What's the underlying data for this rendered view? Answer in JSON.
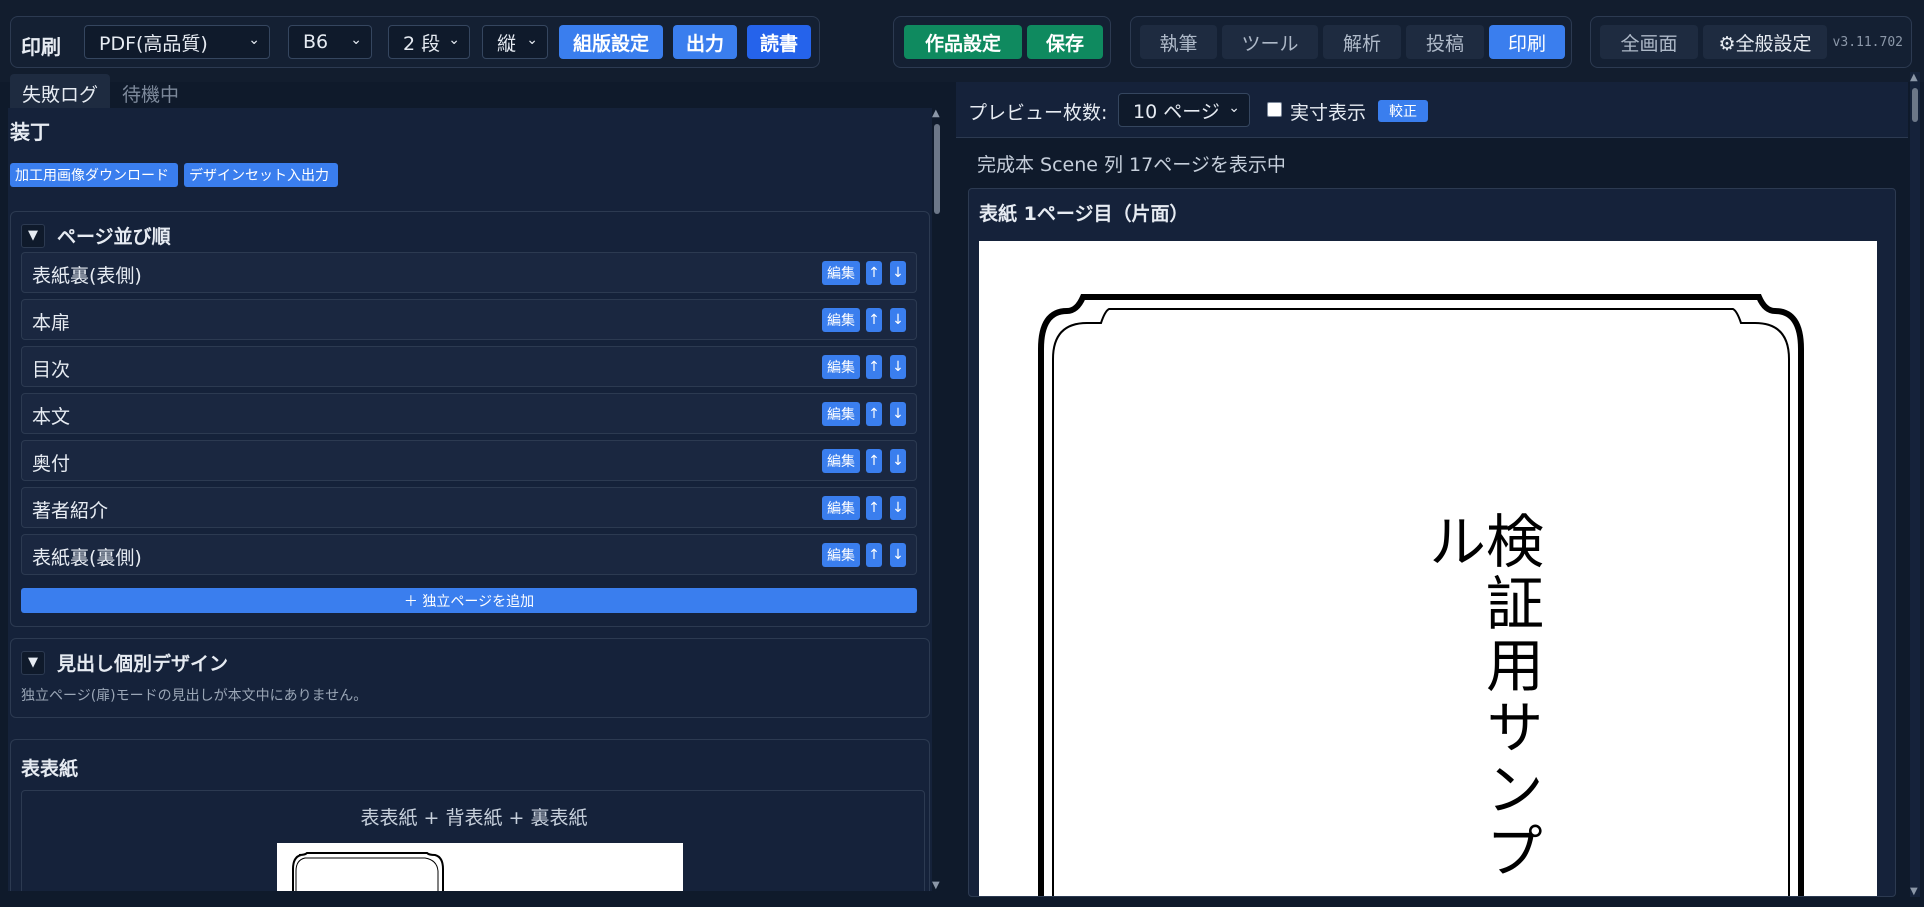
{
  "toolbar": {
    "title": "印刷",
    "format": "PDF(高品質)",
    "size": "B6",
    "columns": "2 段",
    "direction": "縦",
    "layout_btn": "組版設定",
    "output_btn": "出力",
    "read_btn": "読書",
    "work_settings_btn": "作品設定",
    "save_btn": "保存",
    "mode_tabs": [
      "執筆",
      "ツール",
      "解析",
      "投稿",
      "印刷"
    ],
    "fullscreen_btn": "全画面",
    "general_settings_btn": "⚙全般設定",
    "version": "v3.11.702"
  },
  "left": {
    "tabs": [
      "失敗ログ",
      "待機中"
    ],
    "section_title": "装丁",
    "chips": [
      "加工用画像ダウンロード",
      "デザインセット入出力"
    ],
    "page_order": {
      "header": "ページ並び順",
      "items": [
        "表紙裏(表側)",
        "本扉",
        "目次",
        "本文",
        "奥付",
        "著者紹介",
        "表紙裏(裏側)"
      ],
      "edit_label": "編集",
      "up_label": "↑",
      "down_label": "↓",
      "add_label": "＋ 独立ページを追加"
    },
    "heading_design": {
      "header": "見出し個別デザイン",
      "note": "独立ページ(扉)モードの見出しが本文中にありません。"
    },
    "cover": {
      "title": "表表紙",
      "subtitle": "表表紙 + 背表紙 + 裏表紙"
    }
  },
  "right": {
    "preview_label": "プレビュー枚数:",
    "preview_count": "10 ページ",
    "actual_size_label": "実寸表示",
    "proof_btn": "較正",
    "status": "完成本 Scene 列 17ページを表示中",
    "page_label": "表紙 1ページ目（片面）",
    "cover_text": "検証用サンプル"
  }
}
